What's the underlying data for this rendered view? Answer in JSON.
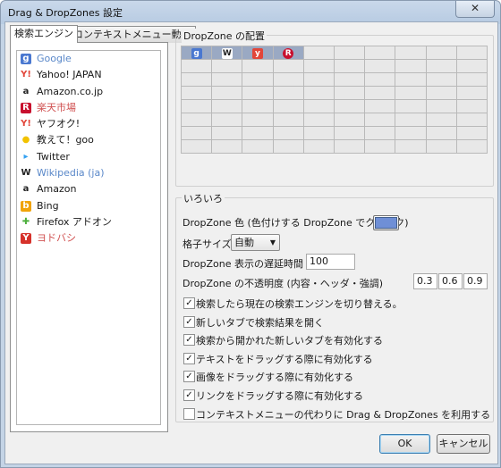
{
  "window": {
    "title": "Drag & DropZones 設定",
    "close_symbol": "✕"
  },
  "tabs": [
    {
      "label": "検索エンジン",
      "active": true
    },
    {
      "label": "コンテキストメニュー動作",
      "active": false
    }
  ],
  "engines": [
    {
      "label": "Google",
      "icon": "google-icon",
      "disabled": true
    },
    {
      "label": "Yahoo! JAPAN",
      "icon": "yahoo-icon",
      "disabled": false
    },
    {
      "label": "Amazon.co.jp",
      "icon": "amazon-icon",
      "disabled": false
    },
    {
      "label": "楽天市場",
      "icon": "rakuten-icon",
      "disabled": true
    },
    {
      "label": "ヤフオク!",
      "icon": "yahoo-icon",
      "disabled": false
    },
    {
      "label": "教えて！goo",
      "icon": "bulb-icon",
      "disabled": false
    },
    {
      "label": "Twitter",
      "icon": "twitter-icon",
      "disabled": false
    },
    {
      "label": "Wikipedia (ja)",
      "icon": "wikipedia-icon",
      "disabled": true
    },
    {
      "label": "Amazon",
      "icon": "amazon-icon",
      "disabled": false
    },
    {
      "label": "Bing",
      "icon": "bing-icon",
      "disabled": false
    },
    {
      "label": "Firefox アドオン",
      "icon": "puzzle-icon",
      "disabled": false
    },
    {
      "label": "ヨドバシ",
      "icon": "yodobashi-icon",
      "disabled": true
    }
  ],
  "dropzone_group": {
    "label": "DropZone の配置",
    "grid_rows": 8,
    "grid_cols": 10,
    "placed": [
      {
        "icon": "google-icon",
        "glyph": "g",
        "color": "#4a78d0"
      },
      {
        "icon": "wikipedia-icon",
        "glyph": "W",
        "color": "#ffffff"
      },
      {
        "icon": "yahoo-icon",
        "glyph": "y",
        "color": "#e2463a"
      },
      {
        "icon": "rakuten-icon",
        "glyph": "R",
        "color": "#c8102e"
      }
    ]
  },
  "misc_group": {
    "label": "いろいろ",
    "color_label": "DropZone 色 (色付けする DropZone でクリック)",
    "color_value": "#6f8fd6",
    "grid_size_label": "格子サイズ",
    "grid_size_value": "自動",
    "delay_label": "DropZone 表示の遅延時間 (ミリ秒)",
    "delay_value": "100",
    "opacity_label": "DropZone の不透明度 (内容・ヘッダ・強調)",
    "opacity_values": [
      "0.3",
      "0.6",
      "0.9"
    ],
    "checkboxes": [
      {
        "label": "検索したら現在の検索エンジンを切り替える。",
        "checked": true
      },
      {
        "label": "新しいタブで検索結果を開く",
        "checked": true
      },
      {
        "label": "検索から開かれた新しいタブを有効化する",
        "checked": true
      },
      {
        "label": "テキストをドラッグする際に有効化する",
        "checked": true
      },
      {
        "label": "画像をドラッグする際に有効化する",
        "checked": true
      },
      {
        "label": "リンクをドラッグする際に有効化する",
        "checked": true
      },
      {
        "label": "コンテキストメニューの代わりに Drag & DropZones を利用する",
        "checked": false
      }
    ]
  },
  "buttons": {
    "ok": "OK",
    "cancel": "キャンセル"
  }
}
